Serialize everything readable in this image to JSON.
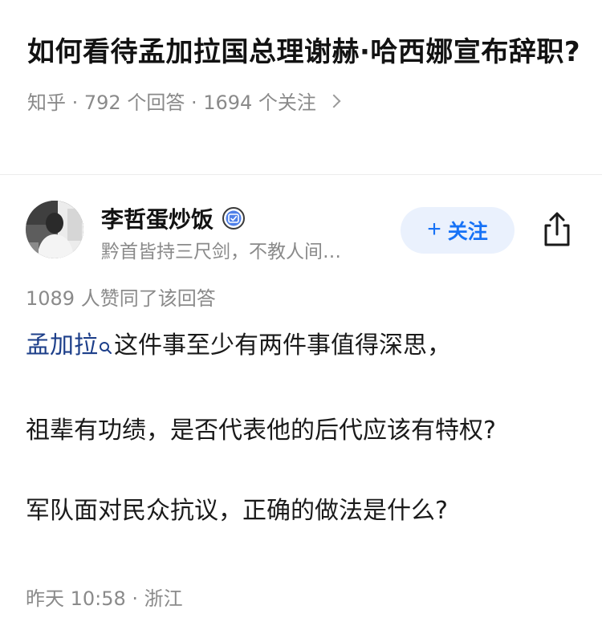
{
  "question": {
    "title": "如何看待孟加拉国总理谢赫·哈西娜宣布辞职?",
    "meta": "知乎 · 792 个回答 · 1694 个关注"
  },
  "author": {
    "name": "李哲蛋炒饭",
    "bio": "黔首皆持三尺剑，不教人间…",
    "follow_label": "关注",
    "follow_plus": "+"
  },
  "vote_text": "1089 人赞同了该回答",
  "answer": {
    "keyword": "孟加拉",
    "p1_rest": "这件事至少有两件事值得深思，",
    "p2": "祖辈有功绩，是否代表他的后代应该有特权?",
    "p3": "军队面对民众抗议，正确的做法是什么?"
  },
  "footer": {
    "time_location": "昨天 10:58 · 浙江"
  },
  "icons": {
    "badge": "verified-badge-icon",
    "share": "share-icon",
    "keyword": "search-icon",
    "chevron": "chevron-right-icon"
  },
  "colors": {
    "accent": "#1772f6",
    "follow_bg": "#eaf1fd",
    "keyword": "#1d3f8a",
    "muted": "#8a8a8a"
  }
}
